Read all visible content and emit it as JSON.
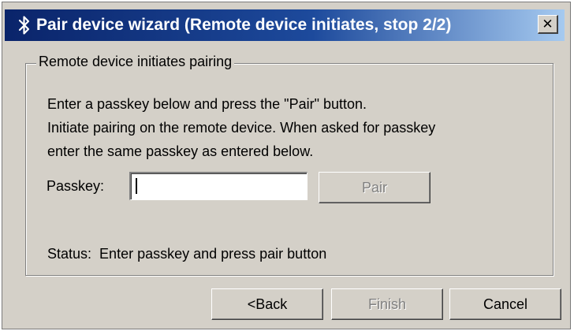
{
  "window": {
    "title": "Pair device wizard (Remote device initiates, stop 2/2)",
    "close_label": "✕",
    "titlebar_color": "#0a246a",
    "face_color": "#d4d0c8"
  },
  "group": {
    "label": "Remote device initiates pairing",
    "instructions": [
      "Enter a passkey below and press the \"Pair\" button.",
      "Initiate pairing on the remote device. When asked for passkey",
      "enter the same passkey as entered below."
    ],
    "passkey_label": "Passkey:",
    "passkey_value": "",
    "pair_label": "Pair",
    "status_label": "Status:",
    "status_text": "Enter passkey and press pair button"
  },
  "footer": {
    "back_label": "<Back",
    "finish_label": "Finish",
    "cancel_label": "Cancel"
  },
  "icons": {
    "title_icon": "bluetooth-icon"
  }
}
